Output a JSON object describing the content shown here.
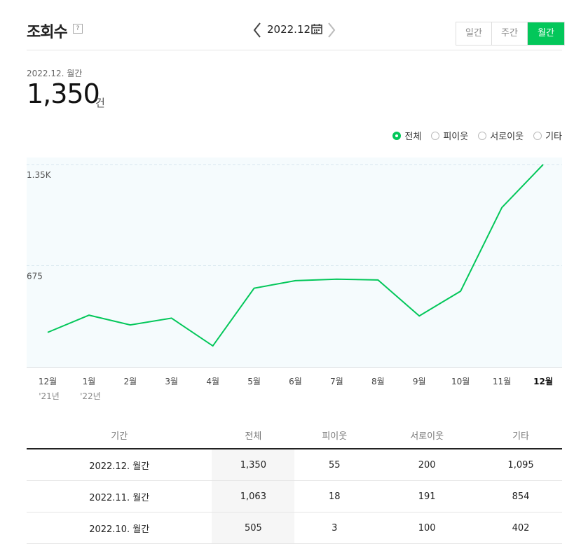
{
  "header": {
    "title": "조회수",
    "help_symbol": "?",
    "date_label": "2022.12.",
    "icons": {
      "prev": "chevron-left-icon",
      "next": "chevron-right-icon",
      "calendar": "calendar-icon"
    },
    "periods": [
      {
        "label": "일간",
        "active": false
      },
      {
        "label": "주간",
        "active": false
      },
      {
        "label": "월간",
        "active": true
      }
    ]
  },
  "summary": {
    "period": "2022.12. 월간",
    "total": "1,350",
    "unit": "건"
  },
  "legend": [
    {
      "label": "전체",
      "selected": true
    },
    {
      "label": "피이웃",
      "selected": false
    },
    {
      "label": "서로이웃",
      "selected": false
    },
    {
      "label": "기타",
      "selected": false
    }
  ],
  "colors": {
    "accent": "#03c75a",
    "plot_bg": "#f5fbfd",
    "grid": "#d6e6ee"
  },
  "chart_data": {
    "type": "line",
    "x": [
      "12월",
      "1월",
      "2월",
      "3월",
      "4월",
      "5월",
      "6월",
      "7월",
      "8월",
      "9월",
      "10월",
      "11월",
      "12월"
    ],
    "year_labels": [
      "'21년",
      "'22년",
      "",
      "",
      "",
      "",
      "",
      "",
      "",
      "",
      "",
      "",
      ""
    ],
    "highlight_index": 12,
    "series": [
      {
        "values": [
          230,
          345,
          280,
          325,
          140,
          525,
          575,
          585,
          580,
          340,
          505,
          1063,
          1350
        ]
      }
    ],
    "yticks": [
      {
        "value": 1350,
        "label": "1.35K"
      },
      {
        "value": 675,
        "label": "675"
      }
    ],
    "ylim": [
      0,
      1350
    ]
  },
  "table": {
    "headers": [
      "기간",
      "전체",
      "피이웃",
      "서로이웃",
      "기타"
    ],
    "rows": [
      [
        "2022.12. 월간",
        "1,350",
        "55",
        "200",
        "1,095"
      ],
      [
        "2022.11. 월간",
        "1,063",
        "18",
        "191",
        "854"
      ],
      [
        "2022.10. 월간",
        "505",
        "3",
        "100",
        "402"
      ]
    ]
  }
}
